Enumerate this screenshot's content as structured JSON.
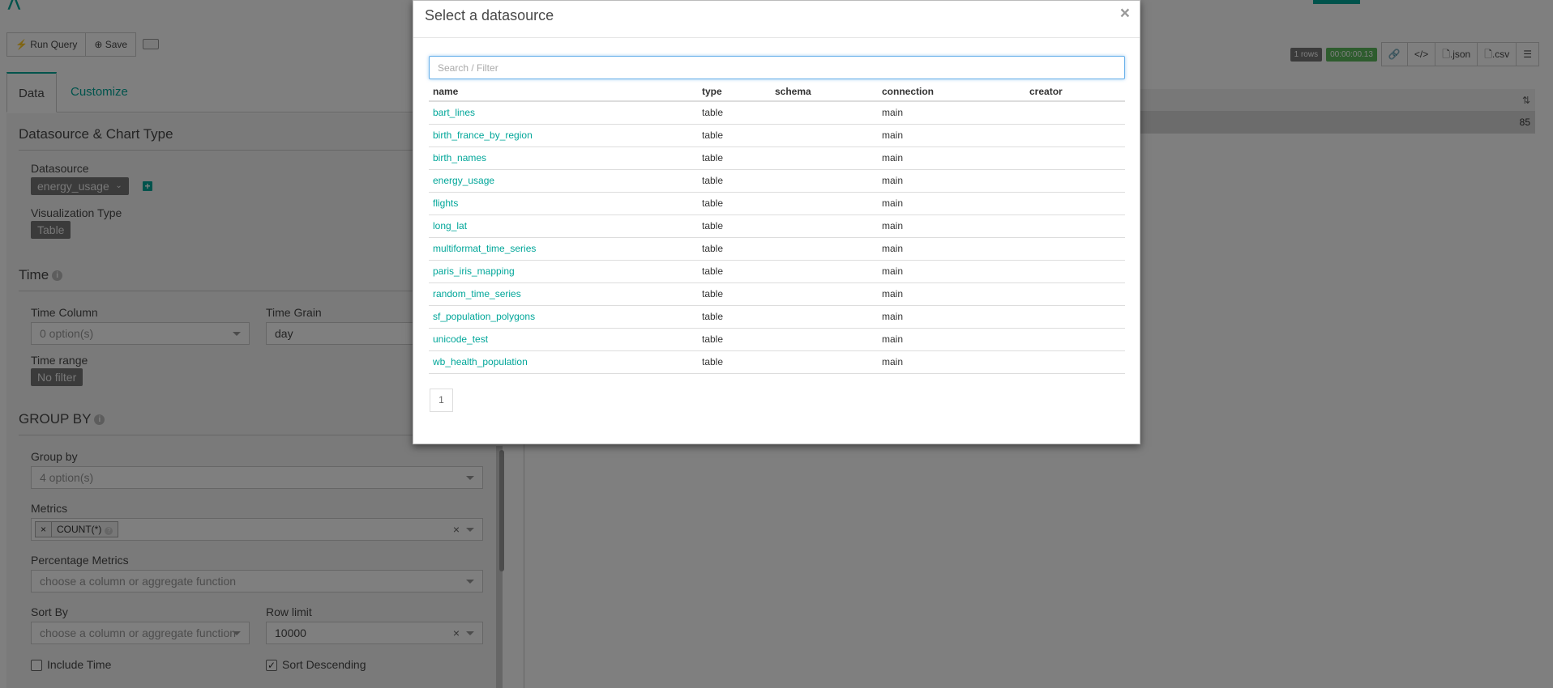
{
  "explore": {
    "toolbar": {
      "run_query": "Run Query",
      "save": "Save"
    },
    "tabs": [
      "Data",
      "Customize"
    ],
    "datasource_section": {
      "title": "Datasource & Chart Type",
      "datasource_label": "Datasource",
      "datasource_value": "energy_usage",
      "viz_label": "Visualization Type",
      "viz_value": "Table"
    },
    "time_section": {
      "title": "Time",
      "time_column_label": "Time Column",
      "time_column_value": "0 option(s)",
      "time_grain_label": "Time Grain",
      "time_grain_value": "day",
      "time_range_label": "Time range",
      "time_range_value": "No filter"
    },
    "groupby_section": {
      "title": "GROUP BY",
      "group_by_label": "Group by",
      "group_by_value": "4 option(s)",
      "metrics_label": "Metrics",
      "metric_tag": "COUNT(*)",
      "pct_metrics_label": "Percentage Metrics",
      "pct_metrics_placeholder": "choose a column or aggregate function",
      "sort_by_label": "Sort By",
      "sort_by_placeholder": "choose a column or aggregate function",
      "row_limit_label": "Row limit",
      "row_limit_value": "10000",
      "include_time_label": "Include Time",
      "sort_desc_label": "Sort Descending"
    },
    "results": {
      "rows_badge": "1 rows",
      "time_badge": "00:00:00.13",
      "json_btn": ".json",
      "csv_btn": ".csv",
      "row_value": "85"
    }
  },
  "modal": {
    "title": "Select a datasource",
    "close": "×",
    "search_placeholder": "Search / Filter",
    "columns": [
      "name",
      "type",
      "schema",
      "connection",
      "creator"
    ],
    "rows": [
      {
        "name": "bart_lines",
        "type": "table",
        "schema": "",
        "connection": "main",
        "creator": ""
      },
      {
        "name": "birth_france_by_region",
        "type": "table",
        "schema": "",
        "connection": "main",
        "creator": ""
      },
      {
        "name": "birth_names",
        "type": "table",
        "schema": "",
        "connection": "main",
        "creator": ""
      },
      {
        "name": "energy_usage",
        "type": "table",
        "schema": "",
        "connection": "main",
        "creator": ""
      },
      {
        "name": "flights",
        "type": "table",
        "schema": "",
        "connection": "main",
        "creator": ""
      },
      {
        "name": "long_lat",
        "type": "table",
        "schema": "",
        "connection": "main",
        "creator": ""
      },
      {
        "name": "multiformat_time_series",
        "type": "table",
        "schema": "",
        "connection": "main",
        "creator": ""
      },
      {
        "name": "paris_iris_mapping",
        "type": "table",
        "schema": "",
        "connection": "main",
        "creator": ""
      },
      {
        "name": "random_time_series",
        "type": "table",
        "schema": "",
        "connection": "main",
        "creator": ""
      },
      {
        "name": "sf_population_polygons",
        "type": "table",
        "schema": "",
        "connection": "main",
        "creator": ""
      },
      {
        "name": "unicode_test",
        "type": "table",
        "schema": "",
        "connection": "main",
        "creator": ""
      },
      {
        "name": "wb_health_population",
        "type": "table",
        "schema": "",
        "connection": "main",
        "creator": ""
      }
    ],
    "pagination": [
      "1"
    ]
  },
  "colors": {
    "accent": "#00a699",
    "tag": "#777777",
    "success": "#5cb85c"
  }
}
